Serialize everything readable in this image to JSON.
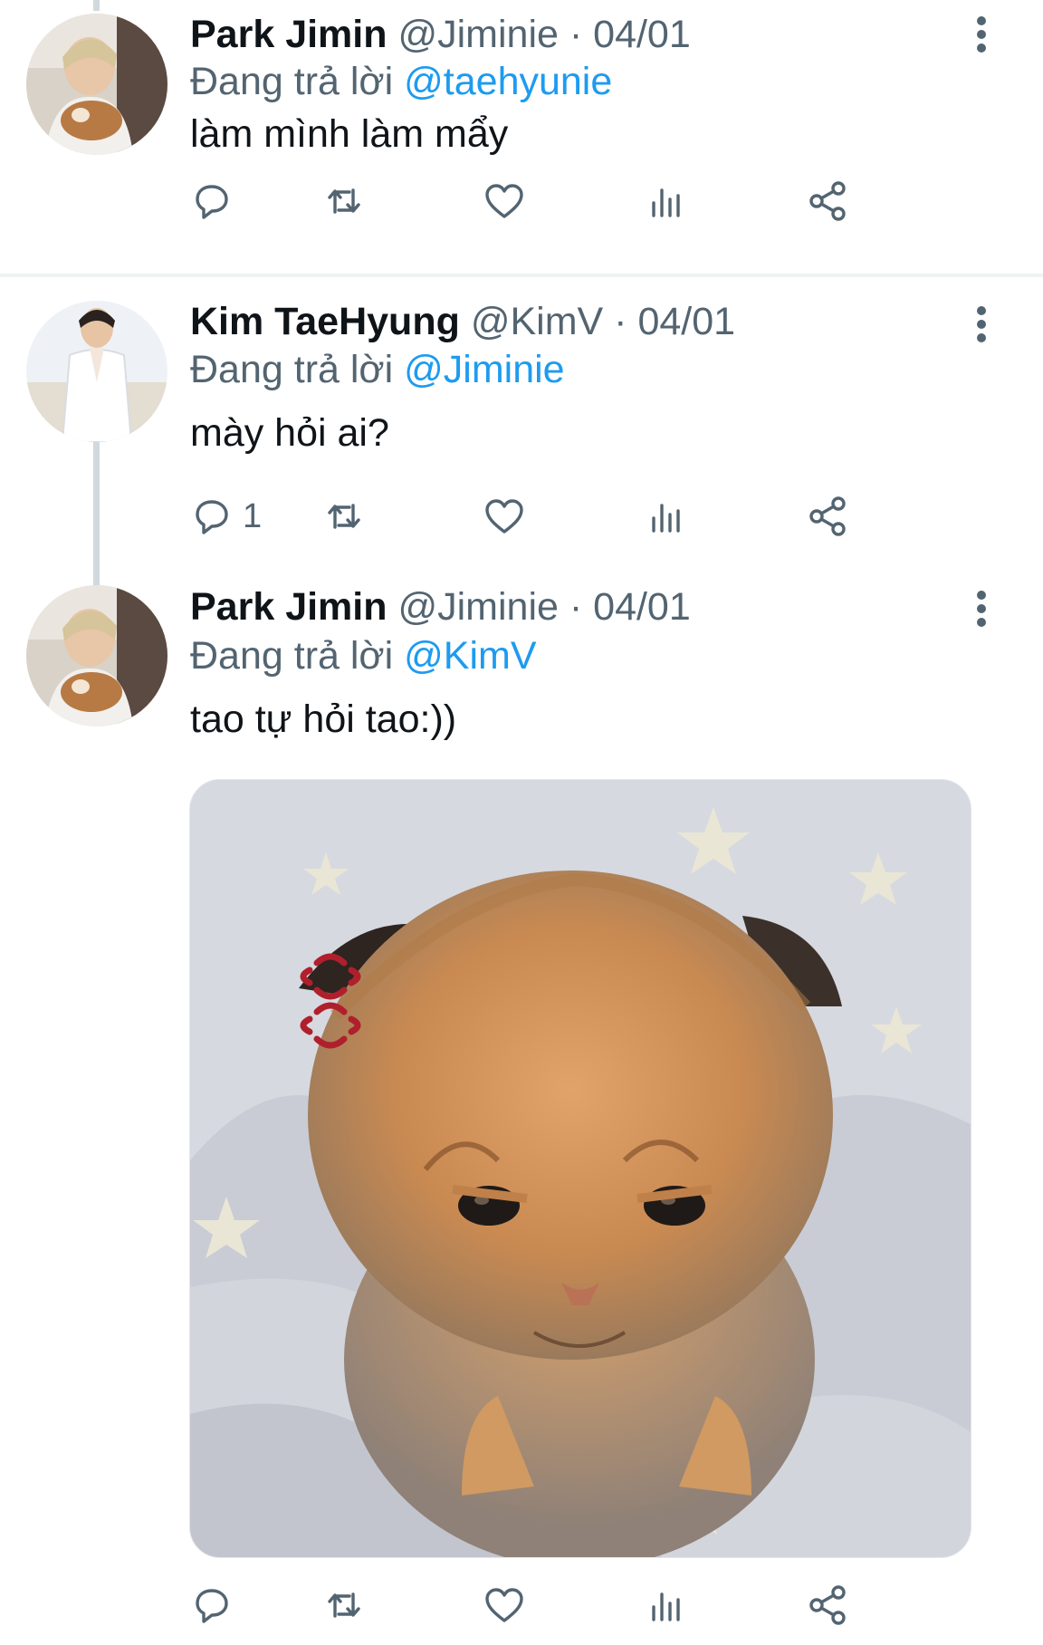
{
  "tweets": [
    {
      "name": "Park Jimin",
      "handle": "@Jiminie",
      "separator": "·",
      "date": "04/01",
      "reply_prefix": "Đang trả lời",
      "reply_to": "@taehyunie",
      "text": "làm mình làm mẩy",
      "reply_count": ""
    },
    {
      "name": "Kim TaeHyung",
      "handle": "@KimV",
      "separator": "·",
      "date": "04/01",
      "reply_prefix": "Đang trả lời",
      "reply_to": "@Jiminie",
      "text": "mày hỏi ai?",
      "reply_count": "1"
    },
    {
      "name": "Park Jimin",
      "handle": "@Jiminie",
      "separator": "·",
      "date": "04/01",
      "reply_prefix": "Đang trả lời",
      "reply_to": "@KimV",
      "text": "tao tự hỏi tao:))",
      "reply_count": "",
      "media": "angry-kitten-image"
    }
  ],
  "icons": {
    "reply": "reply-icon",
    "retweet": "retweet-icon",
    "like": "heart-icon",
    "analytics": "analytics-icon",
    "share": "share-icon",
    "more": "more-vertical-icon"
  },
  "colors": {
    "mention": "#1d9bf0",
    "secondary_text": "#536471",
    "primary_text": "#0f1419",
    "thread_line": "#cfd9de"
  }
}
